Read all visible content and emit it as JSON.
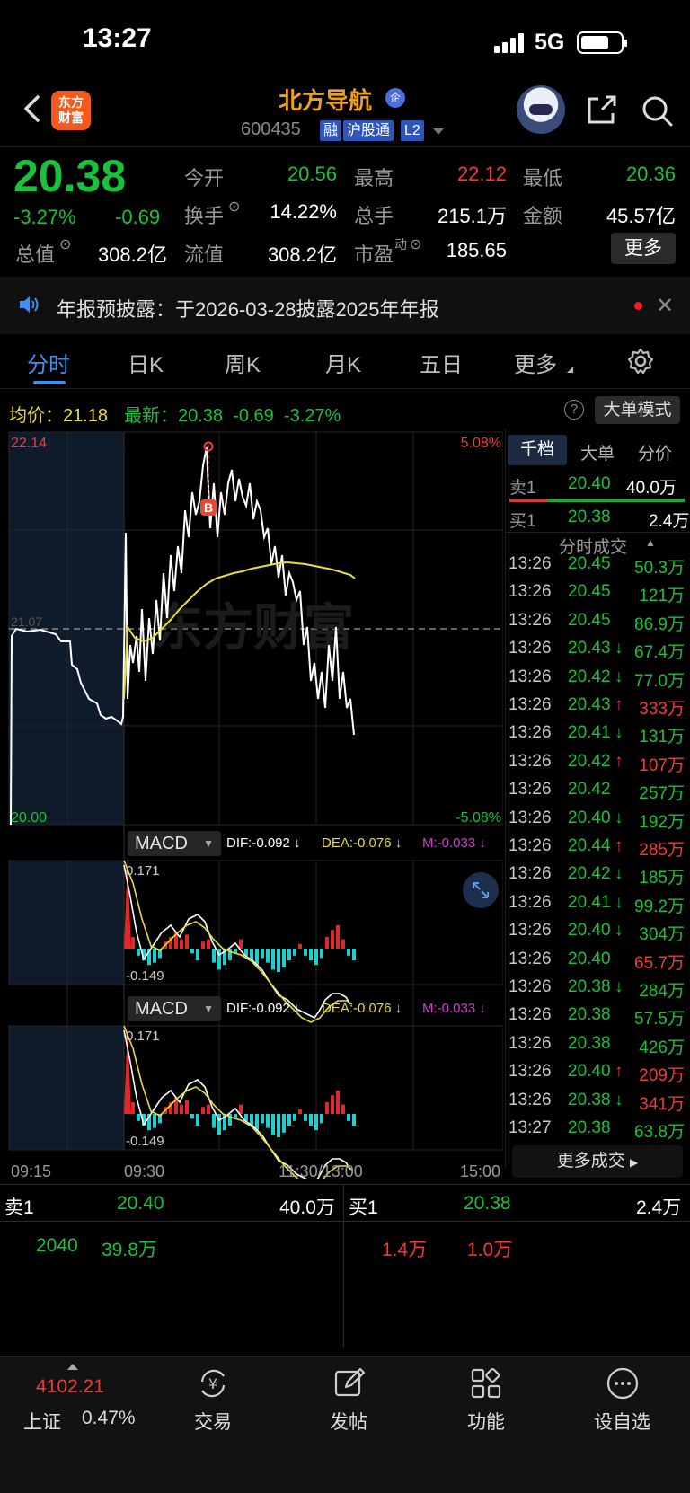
{
  "status_bar": {
    "time": "13:27",
    "network": "5G"
  },
  "header": {
    "logo_text": "东方财富",
    "stock_name": "北方导航",
    "enterprise_badge": "企",
    "stock_code": "600435",
    "tags": [
      "融",
      "沪股通",
      "L2"
    ]
  },
  "quote": {
    "price": "20.38",
    "change_pct": "-3.27%",
    "change": "-0.69",
    "open_label": "今开",
    "open": "20.56",
    "high_label": "最高",
    "high": "22.12",
    "low_label": "最低",
    "low": "20.36",
    "turnover_label": "换手",
    "turnover": "14.22%",
    "volume_label": "总手",
    "volume": "215.1万",
    "amount_label": "金额",
    "amount": "45.57亿",
    "market_cap_label": "总值",
    "market_cap": "308.2亿",
    "float_cap_label": "流值",
    "float_cap": "308.2亿",
    "pe_label": "市盈",
    "pe_sup": "动",
    "pe": "185.65",
    "more_label": "更多"
  },
  "notice": {
    "text": "年报预披露：于2026-03-28披露2025年年报",
    "close": "✕"
  },
  "tabs": [
    "分时",
    "日K",
    "周K",
    "月K",
    "五日",
    "更多"
  ],
  "info_line": {
    "avg_label": "均价：",
    "avg": "21.18",
    "latest_label": "最新：",
    "latest": "20.38",
    "latest_chg": "-0.69",
    "latest_pct": "-3.27%",
    "help": "?",
    "big_mode": "大单模式"
  },
  "chart": {
    "y_max_label": "22.14",
    "y_min_label": "20.00",
    "y_mid_label": "21.07",
    "pct_max_label": "5.08%",
    "pct_min_label": "-5.08%",
    "trade_marker": "B",
    "watermark": "东方财富",
    "time_labels": [
      "09:15",
      "09:30",
      "11:30/13:00",
      "15:00"
    ]
  },
  "macd_panels": [
    {
      "name": "MACD",
      "dif": "DIF:-0.092 ↓",
      "dea": "DEA:-0.076 ↓",
      "m": "M:-0.033 ↓",
      "top": "0.171",
      "bottom": "-0.149"
    },
    {
      "name": "MACD",
      "dif": "DIF:-0.092 ↓",
      "dea": "DEA:-0.076 ↓",
      "m": "M:-0.033 ↓",
      "top": "0.171",
      "bottom": "-0.149"
    }
  ],
  "right_panel": {
    "tabs": [
      "千档",
      "大单",
      "分价"
    ],
    "sell1": {
      "label": "卖1",
      "price": "20.40",
      "vol": "40.0万"
    },
    "buy1": {
      "label": "买1",
      "price": "20.38",
      "vol": "2.4万"
    },
    "deals_header": "分时成交",
    "deals": [
      {
        "time": "13:26",
        "price": "20.45",
        "vol": "50.3万",
        "dir": "",
        "color": "green"
      },
      {
        "time": "13:26",
        "price": "20.45",
        "vol": "121万",
        "dir": "",
        "color": "green"
      },
      {
        "time": "13:26",
        "price": "20.45",
        "vol": "86.9万",
        "dir": "",
        "color": "green"
      },
      {
        "time": "13:26",
        "price": "20.43",
        "vol": "67.4万",
        "dir": "↓",
        "color": "green"
      },
      {
        "time": "13:26",
        "price": "20.42",
        "vol": "77.0万",
        "dir": "↓",
        "color": "green"
      },
      {
        "time": "13:26",
        "price": "20.43",
        "vol": "333万",
        "dir": "↑",
        "color": "red"
      },
      {
        "time": "13:26",
        "price": "20.41",
        "vol": "131万",
        "dir": "↓",
        "color": "green"
      },
      {
        "time": "13:26",
        "price": "20.42",
        "vol": "107万",
        "dir": "↑",
        "color": "red"
      },
      {
        "time": "13:26",
        "price": "20.42",
        "vol": "257万",
        "dir": "",
        "color": "green"
      },
      {
        "time": "13:26",
        "price": "20.40",
        "vol": "192万",
        "dir": "↓",
        "color": "green"
      },
      {
        "time": "13:26",
        "price": "20.44",
        "vol": "285万",
        "dir": "↑",
        "color": "red"
      },
      {
        "time": "13:26",
        "price": "20.42",
        "vol": "185万",
        "dir": "↓",
        "color": "green"
      },
      {
        "time": "13:26",
        "price": "20.41",
        "vol": "99.2万",
        "dir": "↓",
        "color": "green"
      },
      {
        "time": "13:26",
        "price": "20.40",
        "vol": "304万",
        "dir": "↓",
        "color": "green"
      },
      {
        "time": "13:26",
        "price": "20.40",
        "vol": "65.7万",
        "dir": "",
        "color": "red"
      },
      {
        "time": "13:26",
        "price": "20.38",
        "vol": "284万",
        "dir": "↓",
        "color": "green"
      },
      {
        "time": "13:26",
        "price": "20.38",
        "vol": "57.5万",
        "dir": "",
        "color": "green"
      },
      {
        "time": "13:26",
        "price": "20.38",
        "vol": "426万",
        "dir": "",
        "color": "green"
      },
      {
        "time": "13:26",
        "price": "20.40",
        "vol": "209万",
        "dir": "↑",
        "color": "red"
      },
      {
        "time": "13:26",
        "price": "20.38",
        "vol": "341万",
        "dir": "↓",
        "color": "red"
      },
      {
        "time": "13:27",
        "price": "20.38",
        "vol": "63.8万",
        "dir": "",
        "color": "green"
      }
    ],
    "more_deals": "更多成交"
  },
  "order_book": {
    "sell": {
      "label": "卖1",
      "price": "20.40",
      "vol": "40.0万",
      "detail_price": "2040",
      "detail_vol": "39.8万"
    },
    "buy": {
      "label": "买1",
      "price": "20.38",
      "vol": "2.4万",
      "detail_a": "1.4万",
      "detail_b": "1.0万"
    }
  },
  "bottom_nav": {
    "index_value": "4102.21",
    "index_name": "上证",
    "index_pct": "0.47%",
    "items": [
      "交易",
      "发帖",
      "功能",
      "设自选"
    ]
  },
  "colors": {
    "up": "#f03a3a",
    "down": "#18c23a",
    "accent": "#3f8ff0",
    "avg_line": "#e8dd3c",
    "brand": "#f35a1c"
  }
}
